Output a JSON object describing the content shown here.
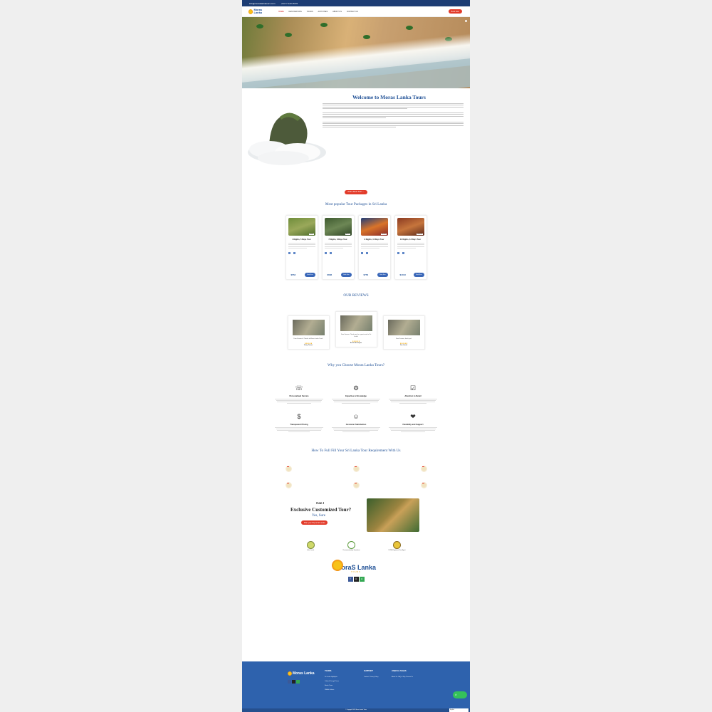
{
  "topbar": {
    "email": "info@moraslankatours.com",
    "phone": "+94 77 123 45 65"
  },
  "nav": {
    "logo_text": "Moras Lanka",
    "items": [
      "Home",
      "Destinations",
      "Tours",
      "Activities",
      "About Us",
      "Contact Us"
    ],
    "cta": "Book Now"
  },
  "welcome": {
    "title": "Welcome to Moras Lanka Tours"
  },
  "browse_button": "Online Book Tours →",
  "packages": {
    "heading": "Most popular Tour Packages in Sri Lanka",
    "items": [
      {
        "title": "4 Nights, 5 Days Tour",
        "tag": "5D/4N",
        "price": "$553",
        "book": "Book Now",
        "color": "#7a8f3c"
      },
      {
        "title": "7 Nights, 8 Days Tour",
        "tag": "8D/7N",
        "price": "$682",
        "book": "Book Now",
        "color": "#4e6a3a"
      },
      {
        "title": "9 Nights, 10 Days Tour",
        "tag": "10D/9N",
        "price": "$752",
        "book": "Book Now",
        "color": "#b04a2a"
      },
      {
        "title": "12 Nights, 13 Days Tour",
        "tag": "13D/12N",
        "price": "$1013",
        "book": "Book Now",
        "color": "#9a4a2c"
      }
    ]
  },
  "reviews": {
    "heading": "OUR REVIEWS",
    "items": [
      {
        "text": "Dear Kumara & Thanks to Moras Lanka Tours!",
        "name": "Vinay Tomar"
      },
      {
        "text": "Dear Kumara, Thank you for a great week in Sri Lanka!",
        "name": "Sonia Henriques"
      },
      {
        "text": "Dear Kumara, thank you!",
        "name": "Jan Lanek"
      }
    ]
  },
  "why": {
    "heading": "Why you Choose Moras Lanka Tours?",
    "items": [
      {
        "icon": "support-icon",
        "glyph": "☏",
        "title": "Personalised Service"
      },
      {
        "icon": "expert-icon",
        "glyph": "⚙",
        "title": "Expertise & Knowledge"
      },
      {
        "icon": "checklist-icon",
        "glyph": "☑",
        "title": "Attention to Detail"
      },
      {
        "icon": "price-tag-icon",
        "glyph": "$",
        "title": "Transparent Pricing"
      },
      {
        "icon": "satisfaction-icon",
        "glyph": "☺",
        "title": "Customer Satisfaction"
      },
      {
        "icon": "support-hands-icon",
        "glyph": "❤",
        "title": "Flexibility and Support"
      }
    ]
  },
  "steps": {
    "heading": "How To Full Fill Your Sri Lanka Tour Requirement With Us",
    "items": [
      {
        "n": "01"
      },
      {
        "n": "02"
      },
      {
        "n": "03"
      },
      {
        "n": "04"
      },
      {
        "n": "05"
      },
      {
        "n": "06"
      }
    ]
  },
  "custom": {
    "can": "Can I",
    "title": "Exclusive Customized Tour?",
    "yes": "Yes, Sure",
    "button": "Plan your Trip to Sri Lanka"
  },
  "badges": [
    {
      "label": "Safe Travels"
    },
    {
      "label": "Recommended by Tripadvisor"
    },
    {
      "label": "SLTDA Registered Tour Agent"
    }
  ],
  "logo2": {
    "name": "MoraS Lanka",
    "sub": "TOURS"
  },
  "footer": {
    "tours_h": "TOURS",
    "tours": [
      "Sri Lanka Highlights",
      "Cultural Triangle Tours",
      "Beach Tours",
      "Wildlife Safaris"
    ],
    "support_h": "SUPPORT",
    "support": [
      "Contact",
      "Privacy Policy"
    ],
    "useful_h": "USEFUL PAGES",
    "useful": [
      "About Us",
      "FAQs",
      "Why Choose Us"
    ],
    "whatsapp": "✆",
    "copyright": "© Copyright 2024 Moras Lanka Tours",
    "language": "English"
  },
  "colors": {
    "primary": "#1e4f95",
    "accent": "#e23b2a",
    "footer": "#2e62ad"
  }
}
